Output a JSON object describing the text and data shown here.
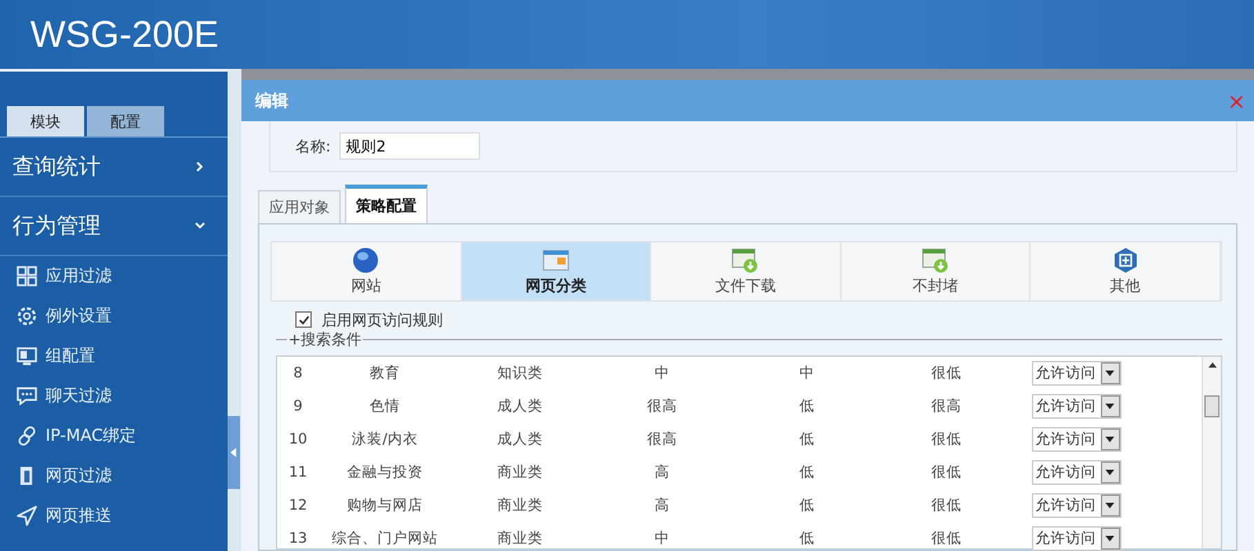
{
  "header": {
    "title": "WSG-200E"
  },
  "sidebar": {
    "tabs": [
      {
        "label": "模块",
        "selected": false
      },
      {
        "label": "配置",
        "selected": true
      }
    ],
    "groups": [
      {
        "label": "查询统计",
        "expanded": false
      },
      {
        "label": "行为管理",
        "expanded": true,
        "children": [
          {
            "label": "应用过滤"
          },
          {
            "label": "例外设置"
          },
          {
            "label": "组配置"
          },
          {
            "label": "聊天过滤"
          },
          {
            "label": "IP-MAC绑定"
          },
          {
            "label": "网页过滤"
          },
          {
            "label": "网页推送"
          }
        ]
      }
    ]
  },
  "dialog": {
    "title": "编辑",
    "close": "×",
    "name_label": "名称:",
    "name_value": "规则2",
    "tabs": [
      {
        "label": "应用对象",
        "selected": false
      },
      {
        "label": "策略配置",
        "selected": true
      }
    ],
    "categories": [
      {
        "label": "网站",
        "selected": false
      },
      {
        "label": "网页分类",
        "selected": true
      },
      {
        "label": "文件下载",
        "selected": false
      },
      {
        "label": "不封堵",
        "selected": false
      },
      {
        "label": "其他",
        "selected": false
      }
    ],
    "enable": {
      "label": "启用网页访问规则",
      "checked": true
    },
    "search_legend": "+搜索条件",
    "rows": [
      {
        "no": "8",
        "name": "教育",
        "type": "知识类",
        "col_4": "中",
        "col_5": "中",
        "col_6": "很低",
        "action": "允许访问"
      },
      {
        "no": "9",
        "name": "色情",
        "type": "成人类",
        "col_4": "很高",
        "col_5": "低",
        "col_6": "很高",
        "action": "允许访问"
      },
      {
        "no": "10",
        "name": "泳装/内衣",
        "type": "成人类",
        "col_4": "很高",
        "col_5": "低",
        "col_6": "很低",
        "action": "允许访问"
      },
      {
        "no": "11",
        "name": "金融与投资",
        "type": "商业类",
        "col_4": "高",
        "col_5": "低",
        "col_6": "很低",
        "action": "允许访问"
      },
      {
        "no": "12",
        "name": "购物与网店",
        "type": "商业类",
        "col_4": "高",
        "col_5": "低",
        "col_6": "很低",
        "action": "允许访问"
      },
      {
        "no": "13",
        "name": "综合、门户网站",
        "type": "商业类",
        "col_4": "中",
        "col_5": "低",
        "col_6": "很低",
        "action": "允许访问"
      }
    ]
  }
}
